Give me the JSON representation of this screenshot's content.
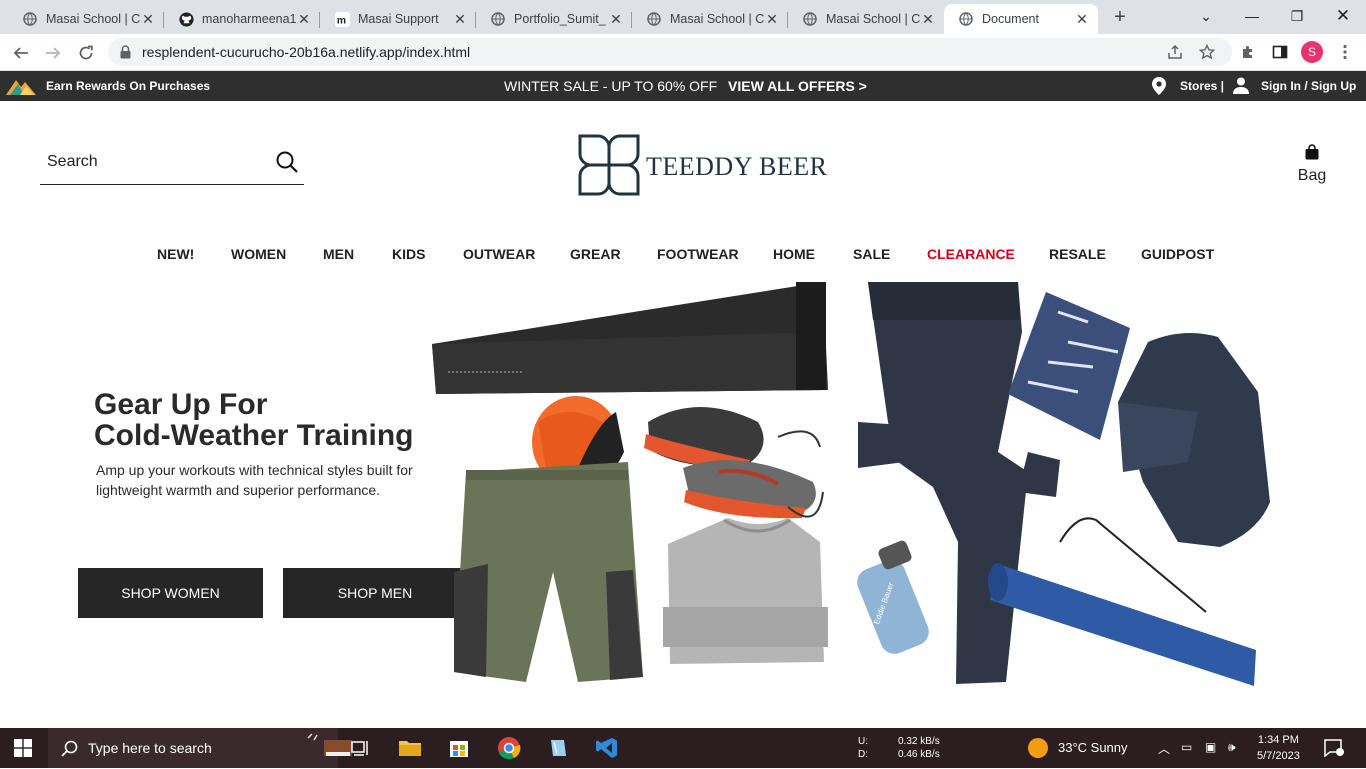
{
  "browser": {
    "tabs": [
      {
        "title": "Masai School | Co",
        "icon": "globe-icon"
      },
      {
        "title": "manoharmeena1",
        "icon": "github-icon"
      },
      {
        "title": "Masai Support",
        "icon": "masai-m-icon"
      },
      {
        "title": "Portfolio_Sumit_",
        "icon": "globe-icon"
      },
      {
        "title": "Masai School | Co",
        "icon": "globe-icon"
      },
      {
        "title": "Masai School | Co",
        "icon": "globe-icon"
      },
      {
        "title": "Document",
        "icon": "globe-icon",
        "active": true
      }
    ],
    "url": "resplendent-cucurucho-20b16a.netlify.app/index.html",
    "profile_initial": "S"
  },
  "promo": {
    "earn": "Earn Rewards On Purchases",
    "sale": "WINTER SALE - UP TO 60% OFF",
    "offers": "VIEW ALL OFFERS >",
    "stores": "Stores |",
    "signin": "Sign In / Sign Up"
  },
  "header": {
    "search_placeholder": "Search",
    "brand": "TEEDDY BEER",
    "bag": "Bag"
  },
  "nav": [
    "NEW!",
    "WOMEN",
    "MEN",
    "KIDS",
    "OUTWEAR",
    "GREAR",
    "FOOTWEAR",
    "HOME",
    "SALE",
    "CLEARANCE",
    "RESALE",
    "GUIDPOST"
  ],
  "hero": {
    "title_line1": "Gear Up For",
    "title_line2": "Cold-Weather Training",
    "subtitle": "Amp up your workouts with technical styles built for lightweight warmth and superior performance.",
    "btn_women": "SHOP WOMEN",
    "btn_men": "SHOP MEN",
    "bottle_text": "Eddie Bauer"
  },
  "taskbar": {
    "search": "Type here to search",
    "net_up_label": "U:",
    "net_down_label": "D:",
    "net_up": "0.32 kB/s",
    "net_down": "0.46 kB/s",
    "weather": "33°C  Sunny",
    "time": "1:34 PM",
    "date": "5/7/2023"
  },
  "colors": {
    "promo_bg": "#2f2f2f",
    "button_bg": "#262626",
    "clearance": "#d0021b",
    "brand_navy": "#1f3340",
    "taskbar_bg": "#2b1d20"
  }
}
